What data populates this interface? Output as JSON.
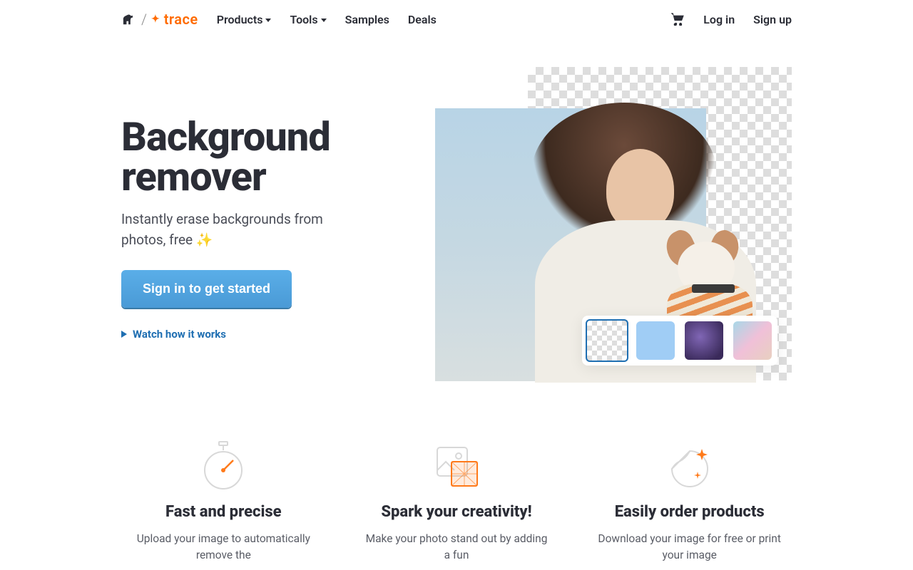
{
  "nav": {
    "products": "Products",
    "tools": "Tools",
    "samples": "Samples",
    "deals": "Deals",
    "login": "Log in",
    "signup": "Sign up",
    "logo_text": "trace"
  },
  "hero": {
    "title": "Background remover",
    "subtitle": "Instantly erase backgrounds from photos, free ✨",
    "cta": "Sign in to get started",
    "watch": "Watch how it works"
  },
  "features": [
    {
      "title": "Fast and precise",
      "desc": "Upload your image to automatically remove the"
    },
    {
      "title": "Spark your creativity!",
      "desc": "Make your photo stand out by adding a fun"
    },
    {
      "title": "Easily order products",
      "desc": "Download your image for free or print your image"
    }
  ]
}
